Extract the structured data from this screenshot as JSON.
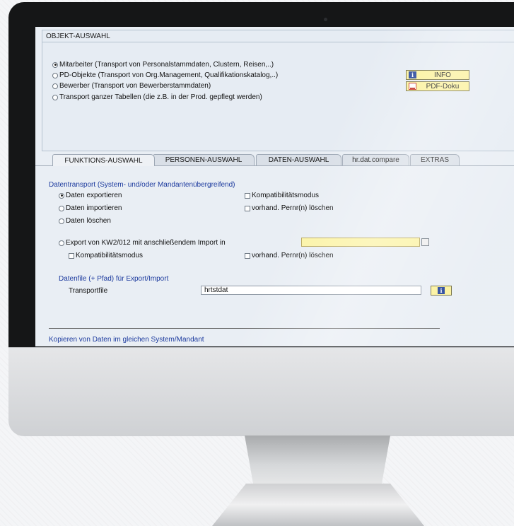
{
  "objekt": {
    "title": "OBJEKT-AUSWAHL",
    "options": [
      {
        "label": "Mitarbeiter   (Transport von Personalstammdaten, Clustern, Reisen,..)",
        "selected": true
      },
      {
        "label": "PD-Objekte (Transport von Org.Management, Qualifikationskatalog,..)",
        "selected": false
      },
      {
        "label": "Bewerber    (Transport von Bewerberstammdaten)",
        "selected": false
      },
      {
        "label": "Transport ganzer Tabellen (die z.B. in der Prod. gepflegt werden)",
        "selected": false
      }
    ],
    "info_button": "INFO",
    "pdf_button": "PDF-Doku"
  },
  "tabs": [
    "FUNKTIONS-AUSWAHL",
    "PERSONEN-AUSWAHL",
    "DATEN-AUSWAHL",
    "hr.dat.compare",
    "EXTRAS"
  ],
  "datentransport": {
    "header": "Datentransport (System- und/oder Mandantenübergreifend)",
    "export": "Daten exportieren",
    "import": "Daten importieren",
    "delete": "Daten löschen",
    "compat": "Kompatibilitätsmodus",
    "delete_pernr": "vorhand. Pernr(n) löschen",
    "kw_export": "Export von KW2/012 mit anschließendem Import in",
    "kw_compat": "Kompatibilitätsmodus",
    "kw_delete_pernr": "vorhand. Pernr(n) löschen",
    "kw_target_value": ""
  },
  "datenfile": {
    "header": "Datenfile (+ Pfad) für Export/Import",
    "label": "Transportfile",
    "value": "hrtstdat"
  },
  "kopieren": {
    "header": "Kopieren von Daten im gleichen System/Mandant"
  },
  "colors": {
    "accent_blue": "#1c3a9e",
    "button_yellow": "#fbf19a",
    "screen_bg": "#e9eef4"
  }
}
